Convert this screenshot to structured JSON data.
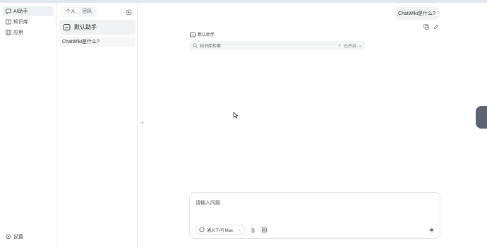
{
  "nav": {
    "items": [
      {
        "label": "AI助手",
        "icon": "chat-icon",
        "active": true
      },
      {
        "label": "知识库",
        "icon": "book-icon",
        "active": false
      },
      {
        "label": "应用",
        "icon": "grid-icon",
        "active": false
      }
    ],
    "settings_label": "设置"
  },
  "list": {
    "tabs": [
      "个人",
      "团队"
    ],
    "assistant_label": "默认助手",
    "conversation_title": "ChatWiki是什么?"
  },
  "chat": {
    "user_message": "ChatWiki是什么?",
    "assistant_name": "默认助手",
    "kb_placeholder": "知识库检索",
    "kb_mode": "已开启"
  },
  "composer": {
    "placeholder": "请输入问题",
    "model_label": "通义千问 Max"
  },
  "colors": {
    "active_bg": "#eef0f3",
    "border": "#e3e5e8",
    "accent": "#5d6470"
  }
}
